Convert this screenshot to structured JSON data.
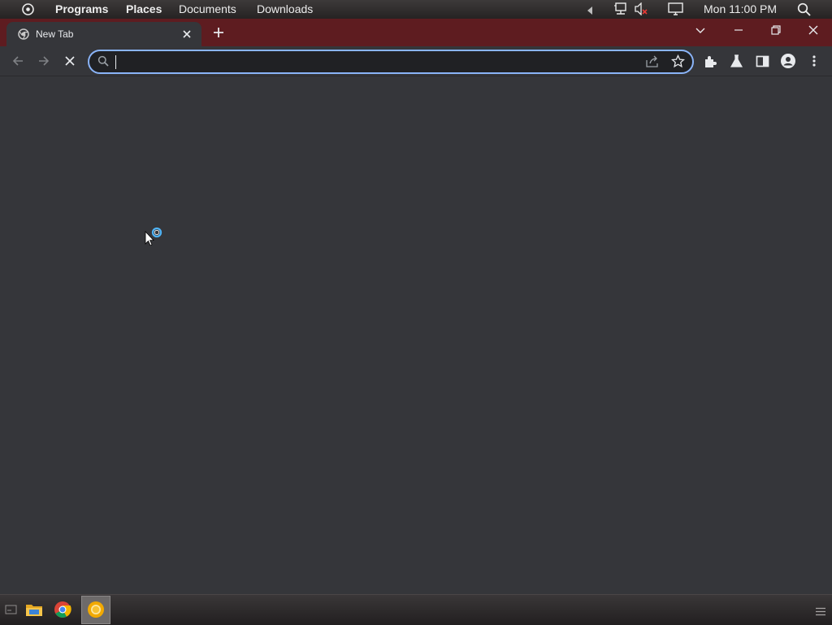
{
  "top_panel": {
    "menus": [
      "Programs",
      "Places",
      "Documents",
      "Downloads"
    ],
    "clock": "Mon 11:00 PM",
    "icons": [
      "app-menu-icon",
      "arrow-left-icon",
      "network-icon",
      "volume-muted-icon",
      "display-icon",
      "search-icon"
    ]
  },
  "browser": {
    "tab": {
      "title": "New Tab",
      "favicon": "chrome-icon"
    },
    "omnibox": {
      "value": "",
      "placeholder": ""
    },
    "accent_color": "#8ab4f8",
    "tabstrip_color": "#5e1c20",
    "background_color": "#35363a"
  },
  "taskbar": {
    "icons": [
      "show-desktop-icon",
      "file-manager-icon",
      "chrome-icon",
      "chrome-canary-icon",
      "task-menu-icon"
    ]
  }
}
